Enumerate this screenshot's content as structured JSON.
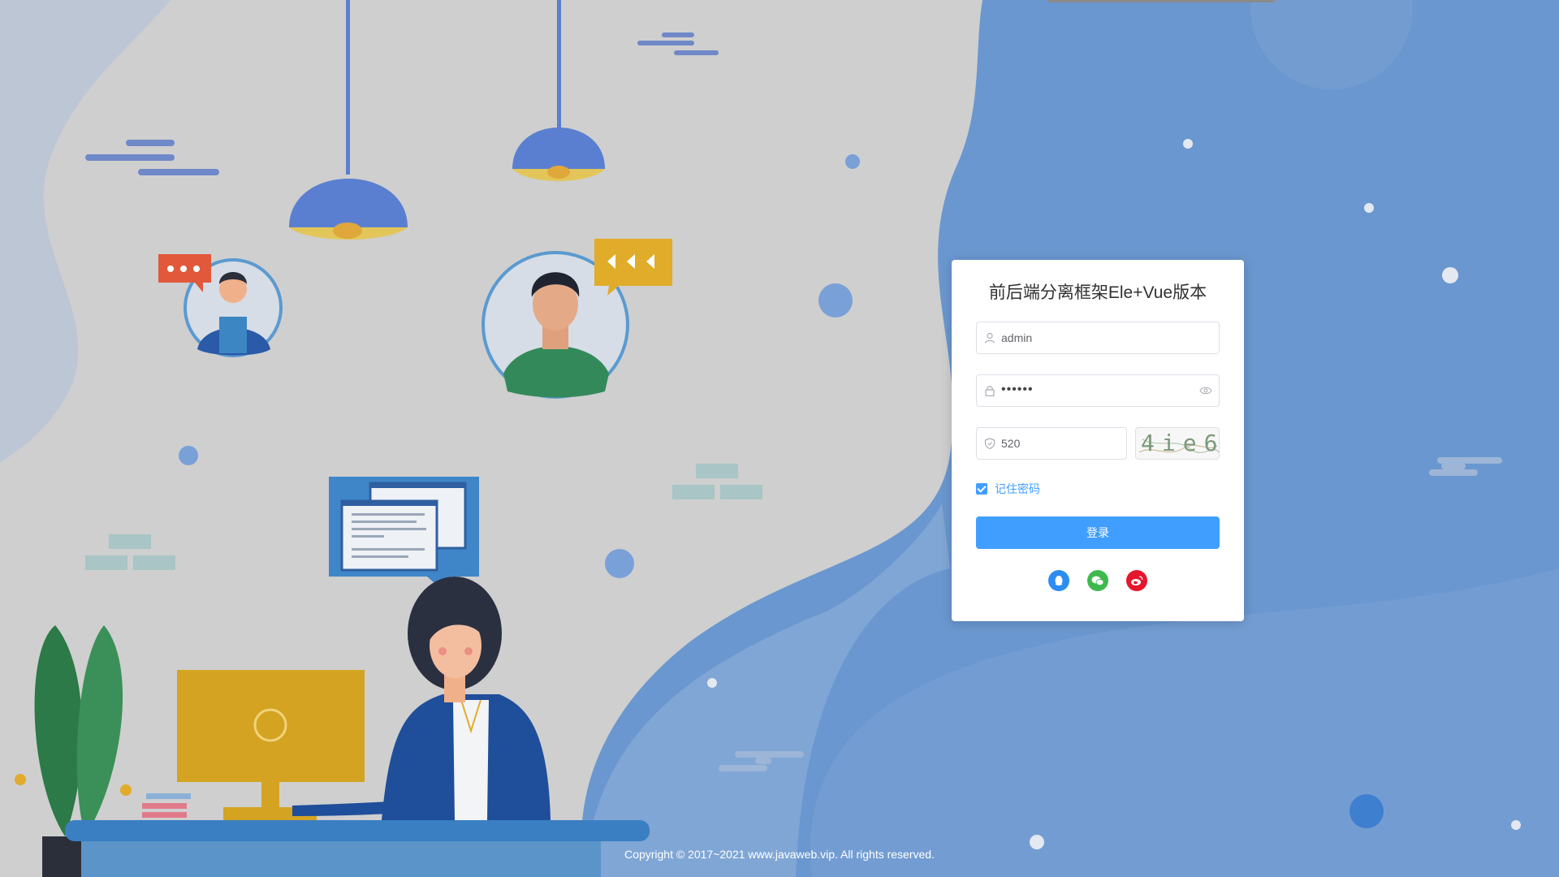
{
  "login": {
    "title": "前后端分离框架Ele+Vue版本",
    "username": "admin",
    "password_mask": "••••••",
    "captcha_value": "520",
    "captcha_image_text": "4ie6",
    "remember_label": "记住密码",
    "login_label": "登录",
    "social": [
      "qq-icon",
      "wechat-icon",
      "weibo-icon"
    ]
  },
  "footer": {
    "copyright": "Copyright © 2017~2021 www.javaweb.vip. All rights reserved."
  },
  "colors": {
    "primary": "#409eff",
    "qq": "#2d8cf0",
    "wechat": "#3eb94e",
    "weibo": "#e6162d"
  }
}
